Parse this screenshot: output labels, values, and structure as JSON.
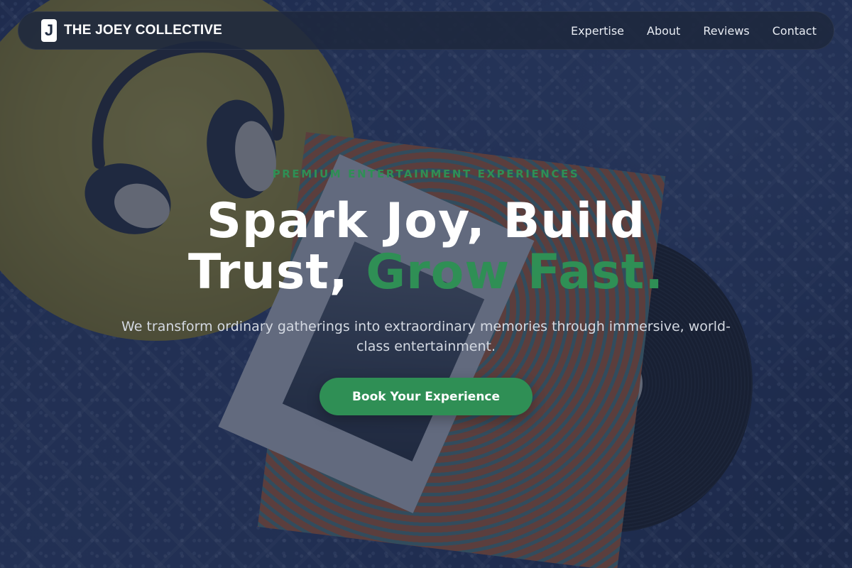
{
  "brand": {
    "logo_letter": "J",
    "name": "THE JOEY COLLECTIVE"
  },
  "nav": {
    "items": [
      {
        "label": "Expertise"
      },
      {
        "label": "About"
      },
      {
        "label": "Reviews"
      },
      {
        "label": "Contact"
      }
    ]
  },
  "hero": {
    "eyebrow": "PREMIUM ENTERTAINMENT EXPERIENCES",
    "headline_line1": "Spark Joy, Build",
    "headline_line2_plain": "Trust, ",
    "headline_line2_accent": "Grow Fast.",
    "subtitle": "We transform ordinary gatherings into extraordinary memories through immersive, world-class entertainment.",
    "cta_label": "Book Your Experience"
  },
  "colors": {
    "accent_green": "#2f8f55",
    "navbar_bg": "#1e283e",
    "overlay": "#18243e"
  }
}
